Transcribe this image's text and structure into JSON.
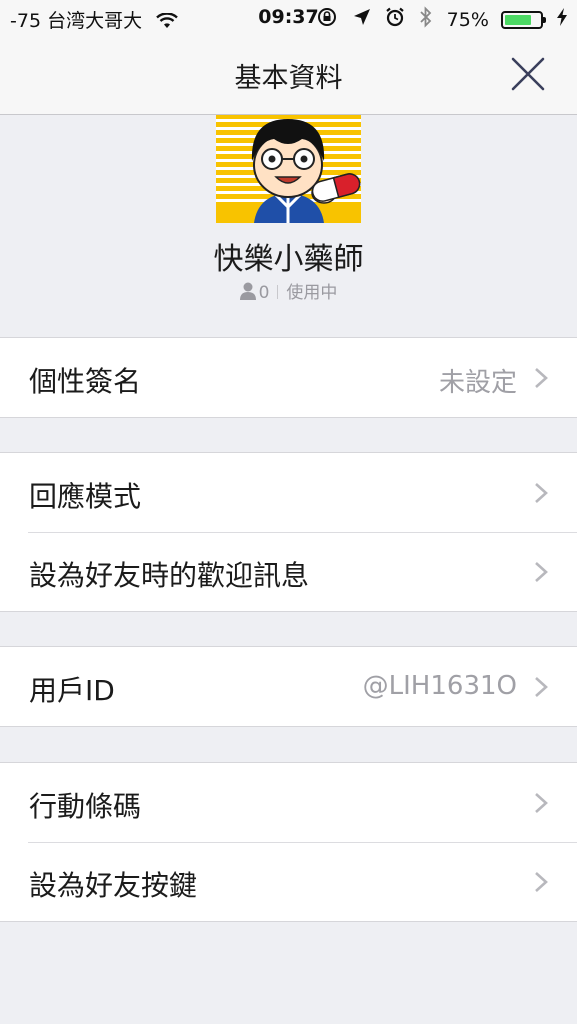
{
  "status_bar": {
    "carrier": "-75 台湾大哥大",
    "time": "09:37",
    "battery_percent": "75%",
    "battery_level": 0.75,
    "battery_color": "#4cd964",
    "icons": [
      "wifi-icon",
      "rotation-lock-icon",
      "location-arrow-icon",
      "alarm-icon",
      "bluetooth-icon",
      "battery-icon",
      "charging-bolt-icon"
    ]
  },
  "nav": {
    "title": "基本資料",
    "close_icon": "close-icon"
  },
  "profile": {
    "name": "快樂小藥師",
    "friend_count": "0",
    "status": "使用中"
  },
  "groups": [
    {
      "rows": [
        {
          "label": "個性簽名",
          "value": "未設定"
        }
      ]
    },
    {
      "rows": [
        {
          "label": "回應模式",
          "value": ""
        },
        {
          "label": "設為好友時的歡迎訊息",
          "value": ""
        }
      ]
    },
    {
      "rows": [
        {
          "label": "用戶ID",
          "value": "@LIH1631O"
        }
      ]
    },
    {
      "rows": [
        {
          "label": "行動條碼",
          "value": ""
        },
        {
          "label": "設為好友按鍵",
          "value": ""
        }
      ]
    }
  ]
}
